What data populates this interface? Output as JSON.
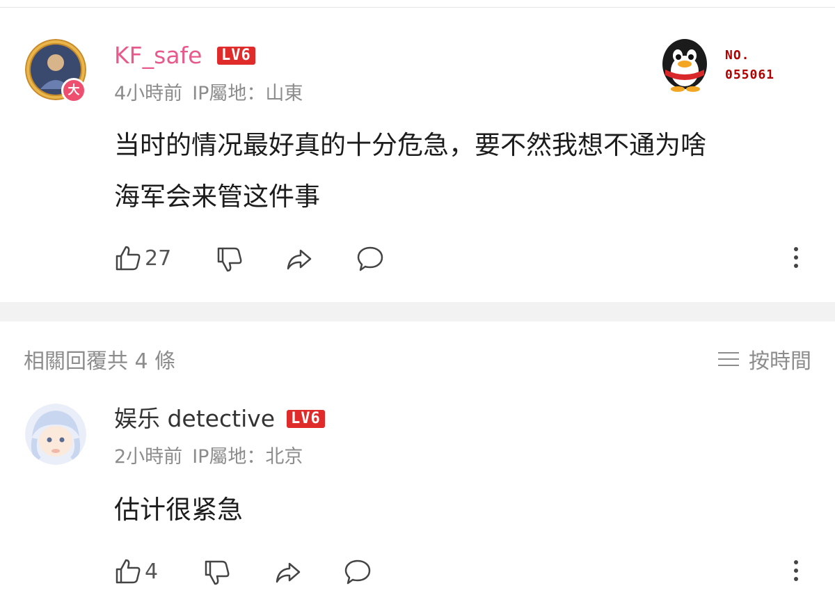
{
  "comment1": {
    "username": "KF_safe",
    "username_color": "#e85a8c",
    "level": "LV6",
    "badge_char": "大",
    "time": "4小時前",
    "ip_location": "IP屬地：山東",
    "text_line1": "当时的情况最好真的十分危急，要不然我想不通为啥",
    "text_line2": "海军会来管这件事",
    "like_count": "27",
    "number_badge_label": "NO.",
    "number_badge_value": "055061",
    "avatar_icon": "hero-portrait-avatar",
    "badge_icon": "penguin-icon"
  },
  "replies_header": {
    "title": "相關回覆共 4 條",
    "sort_label": "按時間",
    "sort_icon": "menu-lines-icon"
  },
  "comment2": {
    "username": "娱乐 detective",
    "level": "LV6",
    "time": "2小時前",
    "ip_location": "IP屬地：北京",
    "text": "估计很紧急",
    "like_count": "4",
    "avatar_icon": "anime-character-avatar"
  },
  "colors": {
    "level_badge": "#e02b2b",
    "meta_text": "#8c8c8c",
    "divider": "#f2f2f2"
  }
}
